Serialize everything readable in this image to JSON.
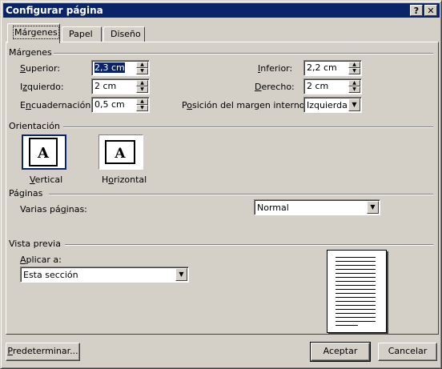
{
  "window": {
    "title": "Configurar página",
    "help_btn": "?",
    "close_btn": "✕"
  },
  "tabs": [
    {
      "label": "Márgenes",
      "active": true
    },
    {
      "label": "Papel",
      "active": false
    },
    {
      "label": "Diseño",
      "active": false
    }
  ],
  "margins": {
    "group_label": "Márgenes",
    "superior": {
      "label_u": "S",
      "label_rest": "uperior:",
      "value": "2,3 cm"
    },
    "izquierdo": {
      "label_pre": "I",
      "label_u": "z",
      "label_rest": "quierdo:",
      "value": "2 cm"
    },
    "encuadernacion": {
      "label_pre": "E",
      "label_u": "n",
      "label_rest": "cuadernación:",
      "value": "0,5 cm"
    },
    "inferior": {
      "label_u": "I",
      "label_rest": "nferior:",
      "value": "2,2 cm"
    },
    "derecho": {
      "label_u": "D",
      "label_rest": "erecho:",
      "value": "2 cm"
    },
    "posicion": {
      "label_pre": "P",
      "label_u": "o",
      "label_rest": "sición del margen interno:",
      "value": "Izquierda"
    }
  },
  "orientation": {
    "group_label": "Orientación",
    "vertical": {
      "label_u": "V",
      "label_rest": "ertical",
      "glyph": "A"
    },
    "horizontal": {
      "label_pre": "H",
      "label_u": "o",
      "label_rest": "rizontal",
      "glyph": "A"
    }
  },
  "pages": {
    "group_label": "Páginas",
    "varias_label_pre": "Varias pá",
    "varias_label_u": "g",
    "varias_label_rest": "inas:",
    "varias_value": "Normal"
  },
  "preview": {
    "group_label": "Vista previa",
    "aplicar_label_u": "A",
    "aplicar_label_rest": "plicar a:",
    "aplicar_value": "Esta sección"
  },
  "buttons": {
    "predeterminar_u": "P",
    "predeterminar_rest": "redeterminar...",
    "aceptar": "Aceptar",
    "cancelar": "Cancelar"
  }
}
